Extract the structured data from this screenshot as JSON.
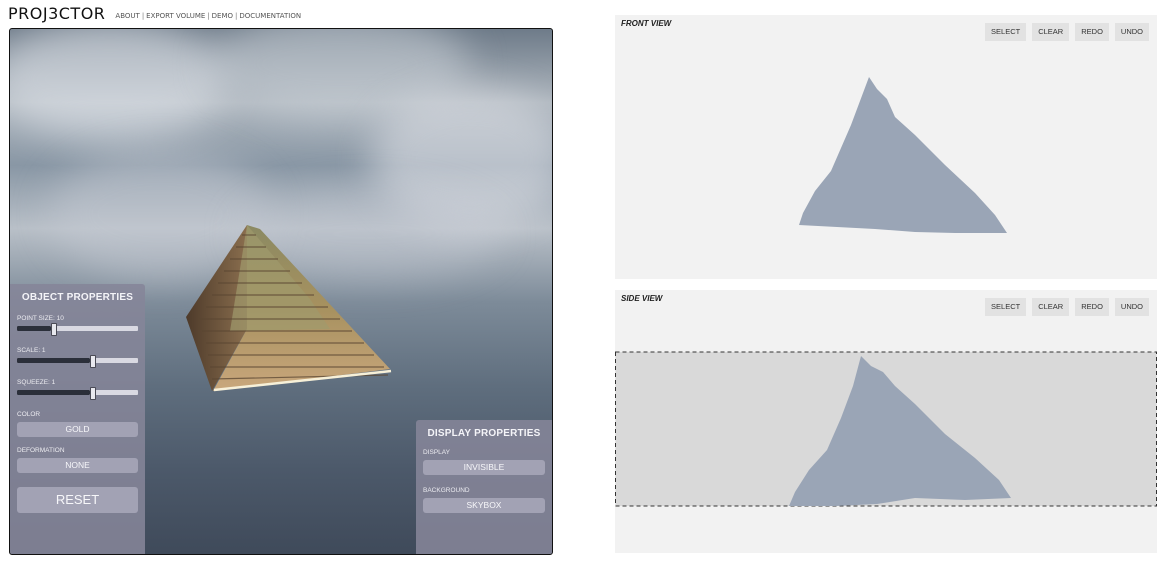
{
  "header": {
    "logo": "PROJ3CTOR",
    "nav": [
      "ABOUT",
      "EXPORT VOLUME",
      "DEMO",
      "DOCUMENTATION"
    ],
    "separator": "|"
  },
  "object_properties": {
    "title": "OBJECT PROPERTIES",
    "point_size": {
      "label": "POINT SIZE: 10",
      "level": 0.28
    },
    "scale": {
      "label": "SCALE: 1",
      "level": 0.6
    },
    "squeeze": {
      "label": "SQUEEZE: 1",
      "level": 0.6
    },
    "color_label": "COLOR",
    "color_value": "GOLD",
    "deformation_label": "DEFORMATION",
    "deformation_value": "NONE",
    "reset": "RESET"
  },
  "display_properties": {
    "title": "DISPLAY PROPERTIES",
    "display_label": "DISPLAY",
    "display_value": "INVISIBLE",
    "background_label": "BACKGROUND",
    "background_value": "SKYBOX"
  },
  "front_view": {
    "title": "FRONT VIEW",
    "buttons": [
      "SELECT",
      "CLEAR",
      "REDO",
      "UNDO"
    ]
  },
  "side_view": {
    "title": "SIDE VIEW",
    "buttons": [
      "SELECT",
      "CLEAR",
      "REDO",
      "UNDO"
    ]
  },
  "colors": {
    "shape_fill": "#9aa5b6",
    "panel_bg": "#858598",
    "button_bg": "#a2a2b4",
    "view_bg": "#f2f2f2",
    "selection_bg": "#d9d9d9"
  }
}
